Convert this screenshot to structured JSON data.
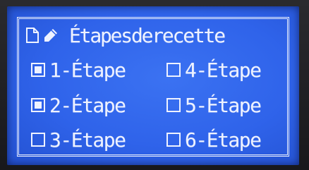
{
  "title": "Étapesderecette",
  "colors": {
    "background": "#2f63ea",
    "foreground": "#eef2ff"
  },
  "icons": {
    "document": "document-icon",
    "pencil": "pencil-icon"
  },
  "steps": [
    {
      "label": "1-Étape",
      "checked": true
    },
    {
      "label": "2-Étape",
      "checked": true
    },
    {
      "label": "3-Étape",
      "checked": false
    },
    {
      "label": "4-Étape",
      "checked": false
    },
    {
      "label": "5-Étape",
      "checked": false
    },
    {
      "label": "6-Étape",
      "checked": false
    }
  ]
}
